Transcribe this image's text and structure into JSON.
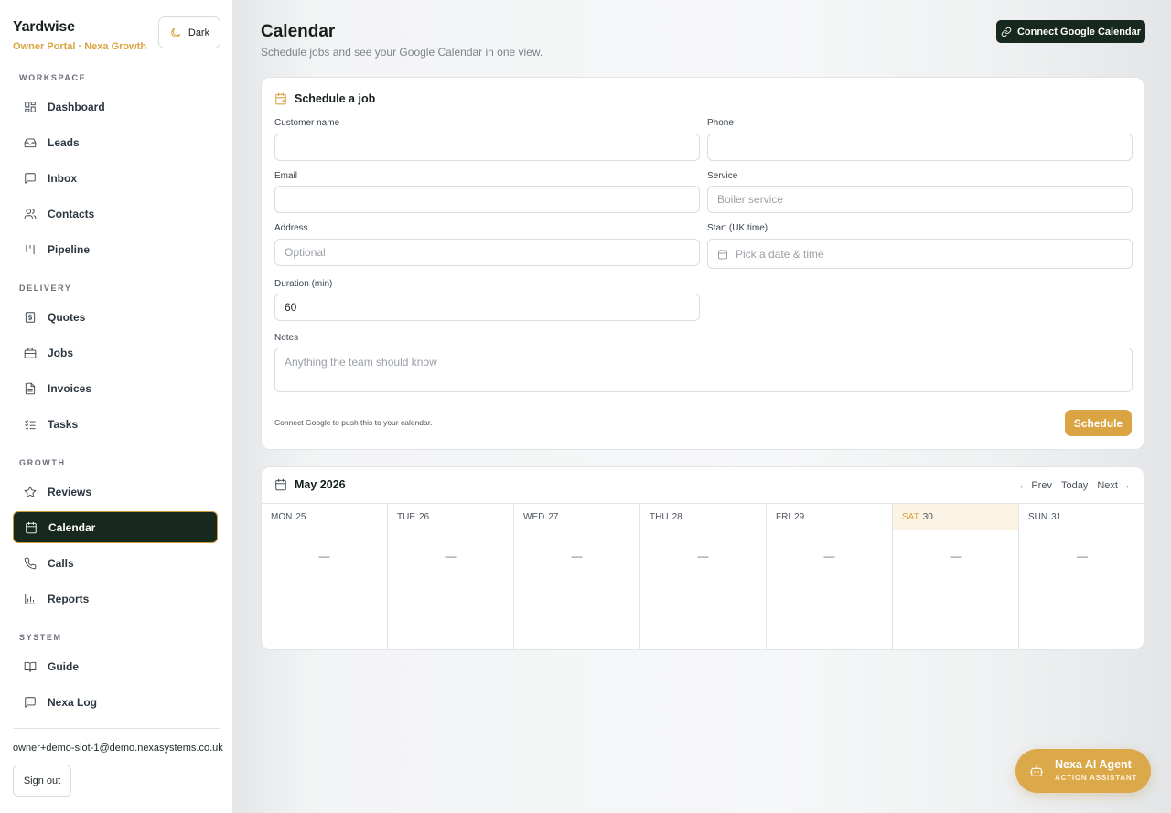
{
  "brand": {
    "name": "Yardwise",
    "subtitle": "Owner Portal · Nexa Growth"
  },
  "theme_toggle": {
    "label": "Dark"
  },
  "sidebar": {
    "sections": [
      {
        "label": "WORKSPACE",
        "items": [
          {
            "label": "Dashboard",
            "icon": "dashboard-icon"
          },
          {
            "label": "Leads",
            "icon": "inbox-tray-icon"
          },
          {
            "label": "Inbox",
            "icon": "chat-icon"
          },
          {
            "label": "Contacts",
            "icon": "users-icon"
          },
          {
            "label": "Pipeline",
            "icon": "pipeline-icon"
          }
        ]
      },
      {
        "label": "DELIVERY",
        "items": [
          {
            "label": "Quotes",
            "icon": "dollar-icon"
          },
          {
            "label": "Jobs",
            "icon": "briefcase-icon"
          },
          {
            "label": "Invoices",
            "icon": "document-icon"
          },
          {
            "label": "Tasks",
            "icon": "checklist-icon"
          }
        ]
      },
      {
        "label": "GROWTH",
        "items": [
          {
            "label": "Reviews",
            "icon": "star-icon"
          },
          {
            "label": "Calendar",
            "icon": "calendar-icon",
            "active": true
          },
          {
            "label": "Calls",
            "icon": "phone-icon"
          },
          {
            "label": "Reports",
            "icon": "bar-chart-icon"
          }
        ]
      },
      {
        "label": "SYSTEM",
        "items": [
          {
            "label": "Guide",
            "icon": "book-icon"
          },
          {
            "label": "Nexa Log",
            "icon": "bot-chat-icon"
          }
        ]
      }
    ],
    "user_email": "owner+demo-slot-1@demo.nexasystems.co.uk",
    "signout_label": "Sign out"
  },
  "header": {
    "title": "Calendar",
    "subtitle": "Schedule jobs and see your Google Calendar in one view.",
    "connect_label": "Connect Google Calendar"
  },
  "form": {
    "title": "Schedule a job",
    "fields": {
      "customer_name": {
        "label": "Customer name",
        "value": "",
        "placeholder": ""
      },
      "phone": {
        "label": "Phone",
        "value": "",
        "placeholder": ""
      },
      "email": {
        "label": "Email",
        "value": "",
        "placeholder": ""
      },
      "service": {
        "label": "Service",
        "value": "",
        "placeholder": "Boiler service"
      },
      "address": {
        "label": "Address",
        "value": "",
        "placeholder": "Optional"
      },
      "start": {
        "label": "Start (UK time)",
        "placeholder": "Pick a date & time"
      },
      "duration": {
        "label": "Duration (min)",
        "value": "60"
      },
      "notes": {
        "label": "Notes",
        "placeholder": "Anything the team should know"
      }
    },
    "note": "Connect Google to push this to your calendar.",
    "submit_label": "Schedule"
  },
  "calendar": {
    "month_label": "May 2026",
    "nav": {
      "prev": "← Prev",
      "today": "Today",
      "next": "Next →"
    },
    "days": [
      {
        "dow": "MON",
        "date": "25",
        "empty": "—"
      },
      {
        "dow": "TUE",
        "date": "26",
        "empty": "—"
      },
      {
        "dow": "WED",
        "date": "27",
        "empty": "—"
      },
      {
        "dow": "THU",
        "date": "28",
        "empty": "—"
      },
      {
        "dow": "FRI",
        "date": "29",
        "empty": "—"
      },
      {
        "dow": "SAT",
        "date": "30",
        "empty": "—",
        "today": true
      },
      {
        "dow": "SUN",
        "date": "31",
        "empty": "—"
      }
    ]
  },
  "agent": {
    "title": "Nexa AI Agent",
    "subtitle": "ACTION ASSISTANT"
  },
  "colors": {
    "brand_dark": "#17291f",
    "accent_gold": "#d9a441"
  }
}
